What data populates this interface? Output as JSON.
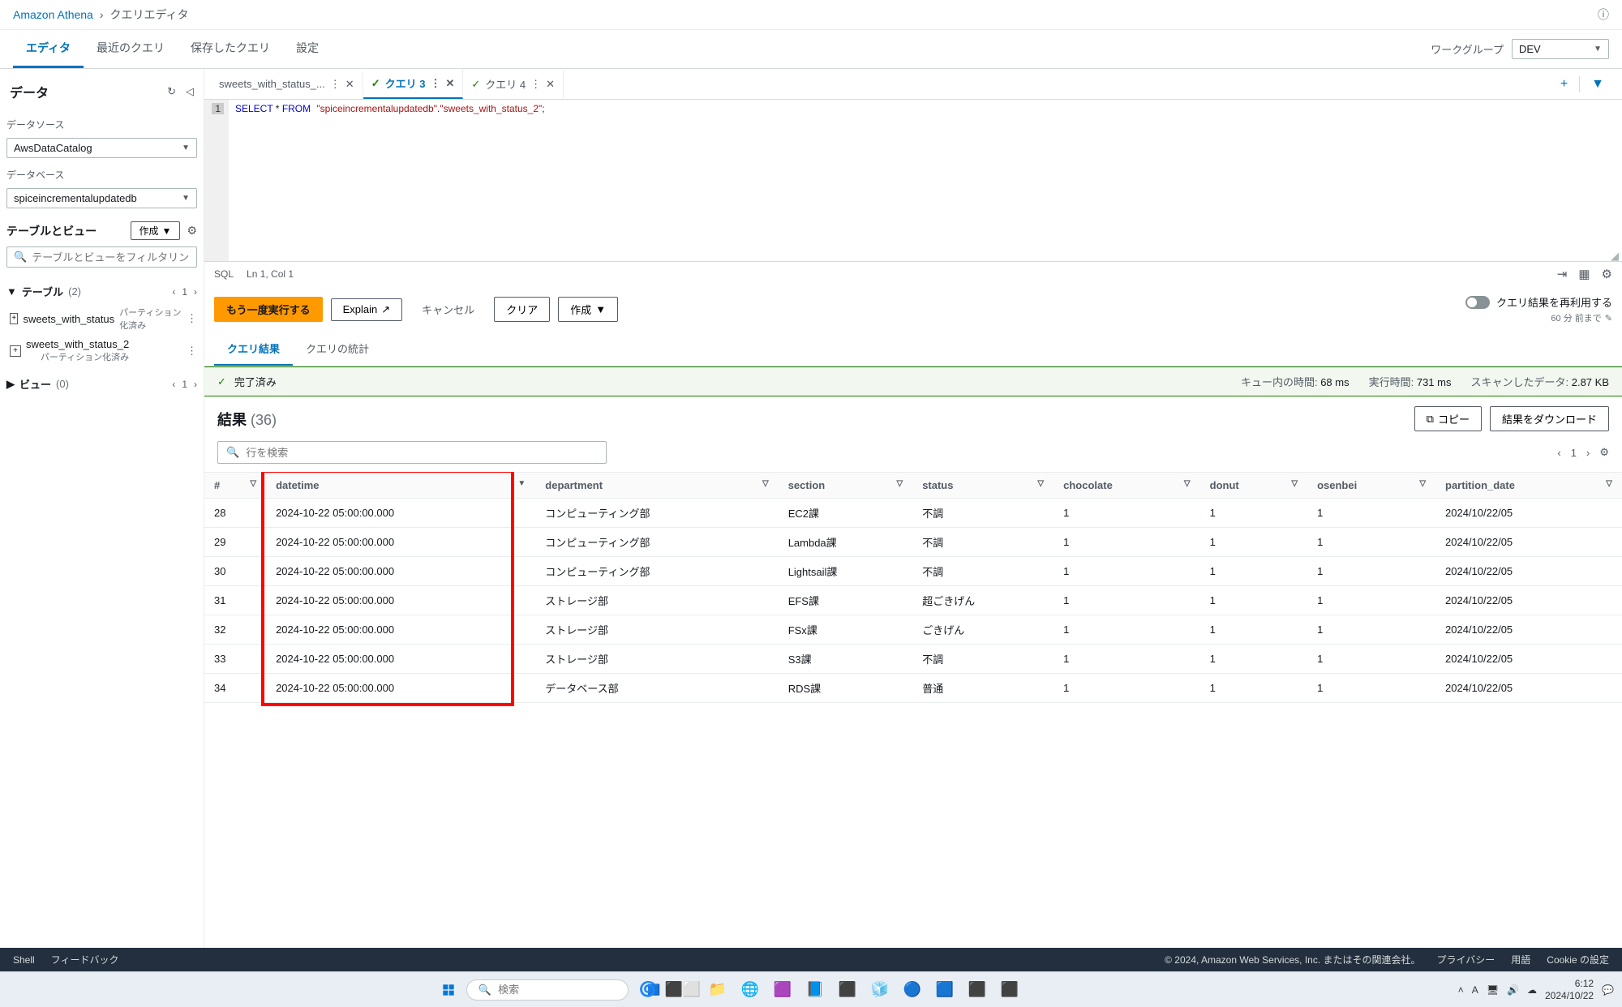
{
  "breadcrumb": {
    "service": "Amazon Athena",
    "page": "クエリエディタ"
  },
  "mainTabs": {
    "editor": "エディタ",
    "recent": "最近のクエリ",
    "saved": "保存したクエリ",
    "settings": "設定"
  },
  "workgroup": {
    "label": "ワークグループ",
    "value": "DEV"
  },
  "sidebar": {
    "data_title": "データ",
    "datasource_label": "データソース",
    "datasource_value": "AwsDataCatalog",
    "database_label": "データベース",
    "database_value": "spiceincrementalupdatedb",
    "tables_views_label": "テーブルとビュー",
    "create_btn": "作成",
    "filter_placeholder": "テーブルとビューをフィルタリング",
    "tables_label": "テーブル",
    "tables_count": "(2)",
    "tables_page": "1",
    "views_label": "ビュー",
    "views_count": "(0)",
    "views_page": "1",
    "table1": "sweets_with_status",
    "table1_badge": "パーティション化済み",
    "table2": "sweets_with_status_2",
    "table2_badge": "パーティション化済み"
  },
  "editorTabs": {
    "t1": "sweets_with_status_...",
    "t3": "クエリ 3",
    "t4": "クエリ 4"
  },
  "sql": {
    "line1": "1",
    "select": "SELECT",
    "star_from": " * ",
    "from": "FROM",
    "db": "\"spiceincrementalupdatedb\"",
    "dot": ".",
    "tbl": "\"sweets_with_status_2\"",
    "semi": ";"
  },
  "editorStatus": {
    "lang": "SQL",
    "pos": "Ln 1, Col 1"
  },
  "actions": {
    "run": "もう一度実行する",
    "explain": "Explain",
    "cancel": "キャンセル",
    "clear": "クリア",
    "create": "作成",
    "reuse": "クエリ結果を再利用する",
    "reuse_sub": "60 分 前まで"
  },
  "resultTabs": {
    "results": "クエリ結果",
    "stats": "クエリの統計"
  },
  "status": {
    "completed": "完了済み",
    "queue_label": "キュー内の時間:",
    "queue_val": "68 ms",
    "run_label": "実行時間:",
    "run_val": "731 ms",
    "scan_label": "スキャンしたデータ:",
    "scan_val": "2.87 KB"
  },
  "results": {
    "title": "結果",
    "count": "(36)",
    "copy": "コピー",
    "download": "結果をダウンロード",
    "search_placeholder": "行を検索",
    "page": "1"
  },
  "columns": {
    "idx": "#",
    "datetime": "datetime",
    "department": "department",
    "section": "section",
    "status": "status",
    "chocolate": "chocolate",
    "donut": "donut",
    "osenbei": "osenbei",
    "partition_date": "partition_date"
  },
  "rows": [
    {
      "idx": "28",
      "datetime": "2024-10-22 05:00:00.000",
      "department": "コンピューティング部",
      "section": "EC2課",
      "status": "不調",
      "chocolate": "1",
      "donut": "1",
      "osenbei": "1",
      "partition_date": "2024/10/22/05"
    },
    {
      "idx": "29",
      "datetime": "2024-10-22 05:00:00.000",
      "department": "コンピューティング部",
      "section": "Lambda課",
      "status": "不調",
      "chocolate": "1",
      "donut": "1",
      "osenbei": "1",
      "partition_date": "2024/10/22/05"
    },
    {
      "idx": "30",
      "datetime": "2024-10-22 05:00:00.000",
      "department": "コンピューティング部",
      "section": "Lightsail課",
      "status": "不調",
      "chocolate": "1",
      "donut": "1",
      "osenbei": "1",
      "partition_date": "2024/10/22/05"
    },
    {
      "idx": "31",
      "datetime": "2024-10-22 05:00:00.000",
      "department": "ストレージ部",
      "section": "EFS課",
      "status": "超ごきげん",
      "chocolate": "1",
      "donut": "1",
      "osenbei": "1",
      "partition_date": "2024/10/22/05"
    },
    {
      "idx": "32",
      "datetime": "2024-10-22 05:00:00.000",
      "department": "ストレージ部",
      "section": "FSx課",
      "status": "ごきげん",
      "chocolate": "1",
      "donut": "1",
      "osenbei": "1",
      "partition_date": "2024/10/22/05"
    },
    {
      "idx": "33",
      "datetime": "2024-10-22 05:00:00.000",
      "department": "ストレージ部",
      "section": "S3課",
      "status": "不調",
      "chocolate": "1",
      "donut": "1",
      "osenbei": "1",
      "partition_date": "2024/10/22/05"
    },
    {
      "idx": "34",
      "datetime": "2024-10-22 05:00:00.000",
      "department": "データベース部",
      "section": "RDS課",
      "status": "普通",
      "chocolate": "1",
      "donut": "1",
      "osenbei": "1",
      "partition_date": "2024/10/22/05"
    }
  ],
  "footer": {
    "shell": "Shell",
    "feedback": "フィードバック",
    "copyright": "© 2024, Amazon Web Services, Inc. またはその関連会社。",
    "privacy": "プライバシー",
    "terms": "用語",
    "cookie": "Cookie の設定"
  },
  "taskbar": {
    "search": "検索",
    "time": "6:12",
    "date": "2024/10/22"
  }
}
